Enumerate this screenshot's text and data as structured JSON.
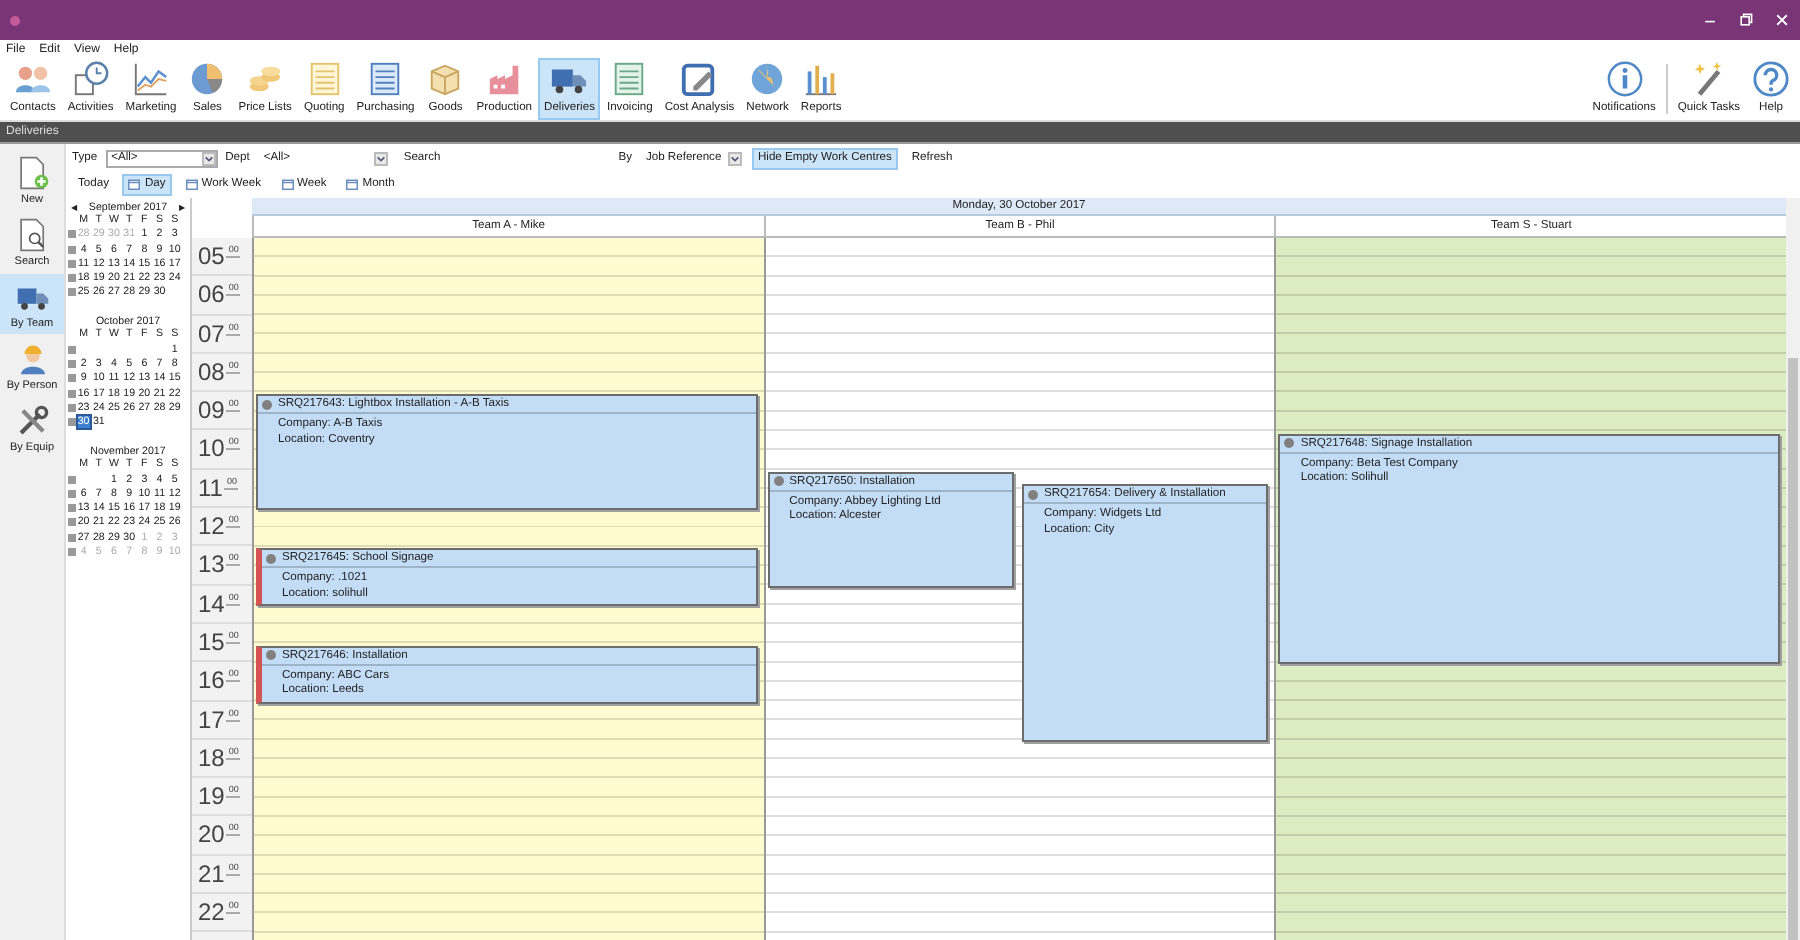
{
  "menu": [
    "File",
    "Edit",
    "View",
    "Help"
  ],
  "toolbar": [
    {
      "label": "Contacts",
      "selected": false
    },
    {
      "label": "Activities",
      "selected": false
    },
    {
      "label": "Marketing",
      "selected": false
    },
    {
      "label": "Sales",
      "selected": false
    },
    {
      "label": "Price Lists",
      "selected": false
    },
    {
      "label": "Quoting",
      "selected": false
    },
    {
      "label": "Purchasing",
      "selected": false
    },
    {
      "label": "Goods",
      "selected": false
    },
    {
      "label": "Production",
      "selected": false
    },
    {
      "label": "Deliveries",
      "selected": true
    },
    {
      "label": "Invoicing",
      "selected": false
    },
    {
      "label": "Cost Analysis",
      "selected": false
    },
    {
      "label": "Network",
      "selected": false
    },
    {
      "label": "Reports",
      "selected": false
    }
  ],
  "toolbar_right": [
    {
      "label": "Notifications"
    },
    {
      "label": "Quick Tasks"
    },
    {
      "label": "Help"
    }
  ],
  "section_title": "Deliveries",
  "filters": {
    "type_label": "Type",
    "type_value": "<All>",
    "dept_label": "Dept",
    "dept_value": "<All>",
    "search_button": "Search",
    "by_label": "By",
    "by_value": "Job Reference",
    "hide_empty": {
      "label": "Hide Empty Work Centres",
      "on": true
    },
    "refresh_button": "Refresh"
  },
  "views": {
    "today_button": "Today",
    "options": [
      {
        "label": "Day",
        "selected": true
      },
      {
        "label": "Work Week",
        "selected": false
      },
      {
        "label": "Week",
        "selected": false
      },
      {
        "label": "Month",
        "selected": false
      }
    ]
  },
  "nav": [
    {
      "label": "New",
      "selected": false
    },
    {
      "label": "Search",
      "selected": false
    },
    {
      "label": "By Team",
      "selected": true
    },
    {
      "label": "By Person",
      "selected": false
    },
    {
      "label": "By Equip",
      "selected": false
    }
  ],
  "calendars": [
    {
      "title": "September 2017",
      "prev": "◀",
      "next": "▶",
      "weekdays": [
        "M",
        "T",
        "W",
        "T",
        "F",
        "S",
        "S"
      ],
      "weeks": [
        {
          "days": [
            {
              "d": "28",
              "muted": true,
              "selected": false
            },
            {
              "d": "29",
              "muted": true,
              "selected": false
            },
            {
              "d": "30",
              "muted": true,
              "selected": false
            },
            {
              "d": "31",
              "muted": true,
              "selected": false
            },
            {
              "d": "1",
              "muted": false,
              "selected": false
            },
            {
              "d": "2",
              "muted": false,
              "selected": false
            },
            {
              "d": "3",
              "muted": false,
              "selected": false
            }
          ]
        },
        {
          "days": [
            {
              "d": "4",
              "muted": false,
              "selected": false
            },
            {
              "d": "5",
              "muted": false,
              "selected": false
            },
            {
              "d": "6",
              "muted": false,
              "selected": false
            },
            {
              "d": "7",
              "muted": false,
              "selected": false
            },
            {
              "d": "8",
              "muted": false,
              "selected": false
            },
            {
              "d": "9",
              "muted": false,
              "selected": false
            },
            {
              "d": "10",
              "muted": false,
              "selected": false
            }
          ]
        },
        {
          "days": [
            {
              "d": "11",
              "muted": false,
              "selected": false
            },
            {
              "d": "12",
              "muted": false,
              "selected": false
            },
            {
              "d": "13",
              "muted": false,
              "selected": false
            },
            {
              "d": "14",
              "muted": false,
              "selected": false
            },
            {
              "d": "15",
              "muted": false,
              "selected": false
            },
            {
              "d": "16",
              "muted": false,
              "selected": false
            },
            {
              "d": "17",
              "muted": false,
              "selected": false
            }
          ]
        },
        {
          "days": [
            {
              "d": "18",
              "muted": false,
              "selected": false
            },
            {
              "d": "19",
              "muted": false,
              "selected": false
            },
            {
              "d": "20",
              "muted": false,
              "selected": false
            },
            {
              "d": "21",
              "muted": false,
              "selected": false
            },
            {
              "d": "22",
              "muted": false,
              "selected": false
            },
            {
              "d": "23",
              "muted": false,
              "selected": false
            },
            {
              "d": "24",
              "muted": false,
              "selected": false
            }
          ]
        },
        {
          "days": [
            {
              "d": "25",
              "muted": false,
              "selected": false
            },
            {
              "d": "26",
              "muted": false,
              "selected": false
            },
            {
              "d": "27",
              "muted": false,
              "selected": false
            },
            {
              "d": "28",
              "muted": false,
              "selected": false
            },
            {
              "d": "29",
              "muted": false,
              "selected": false
            },
            {
              "d": "30",
              "muted": false,
              "selected": false
            }
          ]
        }
      ]
    },
    {
      "title": "October 2017",
      "weekdays": [
        "M",
        "T",
        "W",
        "T",
        "F",
        "S",
        "S"
      ],
      "weeks": [
        {
          "days": [
            {
              "d": "1",
              "muted": false,
              "selected": false
            }
          ]
        },
        {
          "days": [
            {
              "d": "2",
              "muted": false,
              "selected": false
            },
            {
              "d": "3",
              "muted": false,
              "selected": false
            },
            {
              "d": "4",
              "muted": false,
              "selected": false
            },
            {
              "d": "5",
              "muted": false,
              "selected": false
            },
            {
              "d": "6",
              "muted": false,
              "selected": false
            },
            {
              "d": "7",
              "muted": false,
              "selected": false
            },
            {
              "d": "8",
              "muted": false,
              "selected": false
            }
          ]
        },
        {
          "days": [
            {
              "d": "9",
              "muted": false,
              "selected": false
            },
            {
              "d": "10",
              "muted": false,
              "selected": false
            },
            {
              "d": "11",
              "muted": false,
              "selected": false
            },
            {
              "d": "12",
              "muted": false,
              "selected": false
            },
            {
              "d": "13",
              "muted": false,
              "selected": false
            },
            {
              "d": "14",
              "muted": false,
              "selected": false
            },
            {
              "d": "15",
              "muted": false,
              "selected": false
            }
          ]
        },
        {
          "days": [
            {
              "d": "16",
              "muted": false,
              "selected": false
            },
            {
              "d": "17",
              "muted": false,
              "selected": false
            },
            {
              "d": "18",
              "muted": false,
              "selected": false
            },
            {
              "d": "19",
              "muted": false,
              "selected": false
            },
            {
              "d": "20",
              "muted": false,
              "selected": false
            },
            {
              "d": "21",
              "muted": false,
              "selected": false
            },
            {
              "d": "22",
              "muted": false,
              "selected": false
            }
          ]
        },
        {
          "days": [
            {
              "d": "23",
              "muted": false,
              "selected": false
            },
            {
              "d": "24",
              "muted": false,
              "selected": false
            },
            {
              "d": "25",
              "muted": false,
              "selected": false
            },
            {
              "d": "26",
              "muted": false,
              "selected": false
            },
            {
              "d": "27",
              "muted": false,
              "selected": false
            },
            {
              "d": "28",
              "muted": false,
              "selected": false
            },
            {
              "d": "29",
              "muted": false,
              "selected": false
            }
          ]
        },
        {
          "days": [
            {
              "d": "30",
              "muted": false,
              "selected": true
            },
            {
              "d": "31",
              "muted": false,
              "selected": false
            }
          ]
        }
      ]
    },
    {
      "title": "November 2017",
      "weekdays": [
        "M",
        "T",
        "W",
        "T",
        "F",
        "S",
        "S"
      ],
      "weeks": [
        {
          "days": [
            {
              "d": "1",
              "muted": false,
              "selected": false
            },
            {
              "d": "2",
              "muted": false,
              "selected": false
            },
            {
              "d": "3",
              "muted": false,
              "selected": false
            },
            {
              "d": "4",
              "muted": false,
              "selected": false
            },
            {
              "d": "5",
              "muted": false,
              "selected": false
            }
          ]
        },
        {
          "days": [
            {
              "d": "6",
              "muted": false,
              "selected": false
            },
            {
              "d": "7",
              "muted": false,
              "selected": false
            },
            {
              "d": "8",
              "muted": false,
              "selected": false
            },
            {
              "d": "9",
              "muted": false,
              "selected": false
            },
            {
              "d": "10",
              "muted": false,
              "selected": false
            },
            {
              "d": "11",
              "muted": false,
              "selected": false
            },
            {
              "d": "12",
              "muted": false,
              "selected": false
            }
          ]
        },
        {
          "days": [
            {
              "d": "13",
              "muted": false,
              "selected": false
            },
            {
              "d": "14",
              "muted": false,
              "selected": false
            },
            {
              "d": "15",
              "muted": false,
              "selected": false
            },
            {
              "d": "16",
              "muted": false,
              "selected": false
            },
            {
              "d": "17",
              "muted": false,
              "selected": false
            },
            {
              "d": "18",
              "muted": false,
              "selected": false
            },
            {
              "d": "19",
              "muted": false,
              "selected": false
            }
          ]
        },
        {
          "days": [
            {
              "d": "20",
              "muted": false,
              "selected": false
            },
            {
              "d": "21",
              "muted": false,
              "selected": false
            },
            {
              "d": "22",
              "muted": false,
              "selected": false
            },
            {
              "d": "23",
              "muted": false,
              "selected": false
            },
            {
              "d": "24",
              "muted": false,
              "selected": false
            },
            {
              "d": "25",
              "muted": false,
              "selected": false
            },
            {
              "d": "26",
              "muted": false,
              "selected": false
            }
          ]
        },
        {
          "days": [
            {
              "d": "27",
              "muted": false,
              "selected": false
            },
            {
              "d": "28",
              "muted": false,
              "selected": false
            },
            {
              "d": "29",
              "muted": false,
              "selected": false
            },
            {
              "d": "30",
              "muted": false,
              "selected": false
            },
            {
              "d": "1",
              "muted": true,
              "selected": false
            },
            {
              "d": "2",
              "muted": true,
              "selected": false
            },
            {
              "d": "3",
              "muted": true,
              "selected": false
            }
          ]
        },
        {
          "days": [
            {
              "d": "4",
              "muted": true,
              "selected": false
            },
            {
              "d": "5",
              "muted": true,
              "selected": false
            },
            {
              "d": "6",
              "muted": true,
              "selected": false
            },
            {
              "d": "7",
              "muted": true,
              "selected": false
            },
            {
              "d": "8",
              "muted": true,
              "selected": false
            },
            {
              "d": "9",
              "muted": true,
              "selected": false
            },
            {
              "d": "10",
              "muted": true,
              "selected": false
            }
          ]
        }
      ]
    }
  ],
  "schedule": {
    "date": "Monday, 30 October 2017",
    "hours": [
      {
        "hour": "05",
        "minutes": "00"
      },
      {
        "hour": "06",
        "minutes": "00"
      },
      {
        "hour": "07",
        "minutes": "00"
      },
      {
        "hour": "08",
        "minutes": "00"
      },
      {
        "hour": "09",
        "minutes": "00"
      },
      {
        "hour": "10",
        "minutes": "00"
      },
      {
        "hour": "11",
        "minutes": "00"
      },
      {
        "hour": "12",
        "minutes": "00"
      },
      {
        "hour": "13",
        "minutes": "00"
      },
      {
        "hour": "14",
        "minutes": "00"
      },
      {
        "hour": "15",
        "minutes": "00"
      },
      {
        "hour": "16",
        "minutes": "00"
      },
      {
        "hour": "17",
        "minutes": "00"
      },
      {
        "hour": "18",
        "minutes": "00"
      },
      {
        "hour": "19",
        "minutes": "00"
      },
      {
        "hour": "20",
        "minutes": "00"
      },
      {
        "hour": "21",
        "minutes": "00"
      },
      {
        "hour": "22",
        "minutes": "00"
      }
    ],
    "teams": [
      {
        "name": "Team A - Mike",
        "color": "#fffbd0",
        "events": [
          {
            "title": "SRQ217643: Lightbox Installation - A-B Taxis",
            "company": "Company: A-B Taxis",
            "location": "Location: Coventry",
            "flagged": false
          },
          {
            "title": "SRQ217645: School Signage",
            "company": "Company: .1021",
            "location": "Location: solihull",
            "flagged": true
          },
          {
            "title": "SRQ217646: Installation",
            "company": "Company: ABC Cars",
            "location": "Location: Leeds",
            "flagged": true
          }
        ]
      },
      {
        "name": "Team B - Phil",
        "color": "#ffffff",
        "events": [
          {
            "title": "SRQ217650: Installation",
            "company": "Company: Abbey Lighting Ltd",
            "location": "Location: Alcester",
            "flagged": false
          },
          {
            "title": "SRQ217654: Delivery & Installation",
            "company": "Company: Widgets Ltd",
            "location": "Location: City",
            "flagged": false
          }
        ]
      },
      {
        "name": "Team S - Stuart",
        "color": "#dcedc4",
        "events": [
          {
            "title": "SRQ217648: Signage Installation",
            "company": "Company: Beta Test Company",
            "location": "Location: Solihull",
            "flagged": false
          }
        ]
      }
    ]
  }
}
